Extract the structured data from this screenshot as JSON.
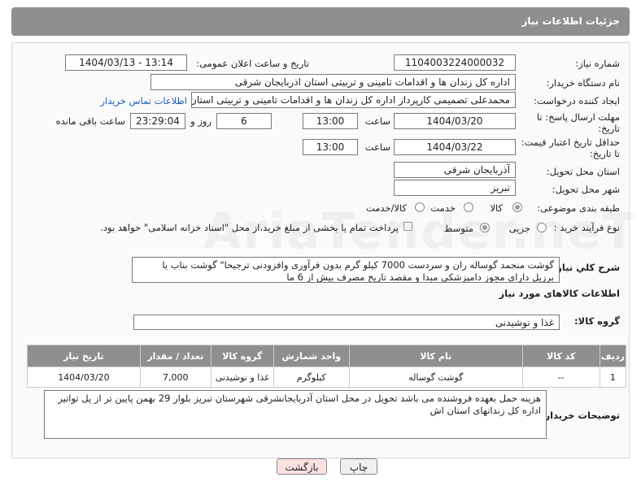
{
  "header": {
    "title": "جزئیات اطلاعات نیاز"
  },
  "form": {
    "need_number": {
      "label": "شماره نیاز:",
      "value": "1104003224000032"
    },
    "announce_datetime": {
      "label": "تاریخ و ساعت اعلان عمومی:",
      "value": "1404/03/13 - 13:14"
    },
    "buyer_org": {
      "label": "نام دستگاه خریدار:",
      "value": "اداره کل زندان ها و اقدامات تامینی و تربیتی استان اذربایجان شرقی"
    },
    "requester": {
      "label": "ایجاد کننده درخواست:",
      "value": "محمدعلی تصمیمی کارپرداز اداره کل زندان ها و اقدامات تامینی و تربیتی استان",
      "contact_link": "اطلاعات تماس خریدار"
    },
    "reply_deadline": {
      "label_1": "مهلت ارسال پاسخ: تا",
      "label_2": "تاریخ:",
      "date": "1404/03/20",
      "time_label": "ساعت",
      "time": "13:00",
      "days": "6",
      "days_label": "روز و",
      "remaining": "23:29:04",
      "remaining_label": "ساعت باقی مانده"
    },
    "price_validity": {
      "label_1": "حداقل تاریخ اعتبار قیمت:",
      "label_2": "تا تاریخ:",
      "date": "1404/03/22",
      "time_label": "ساعت",
      "time": "13:00"
    },
    "delivery_province": {
      "label": "استان محل تحویل:",
      "value": "آذربایجان شرقی"
    },
    "delivery_city": {
      "label": "شهر محل تحویل:",
      "value": "تبریز"
    },
    "category": {
      "label": "طبقه بندی موضوعی:",
      "options": [
        "کالا",
        "خدمت",
        "کالا/خدمت"
      ],
      "selected": "کالا"
    },
    "purchase_type": {
      "label": "نوع فرآیند خرید :",
      "options": [
        "جزیی",
        "متوسط"
      ],
      "selected": "متوسط",
      "note": "پرداخت تمام یا بخشی از مبلغ خرید،از محل \"اسناد خزانه اسلامی\" خواهد بود."
    },
    "description": {
      "label": "شرح کلي نياز:",
      "value": "گوشت منجمد گوساله ران و سردست 7000 کیلو گرم بدون فرآوری وافزودنی ترجیحا\" گوشت بناب یا برزیل دارای مجوز دامپزشکی مبدا و مقصد تاریخ مصرف بیش از 6 ما"
    }
  },
  "goods": {
    "section_title": "اطلاعات کالاهای مورد نیاز",
    "group_label": "گروه کالا:",
    "group_value": "غذا و نوشیدنی",
    "columns": [
      "ردیف",
      "کد کالا",
      "نام کالا",
      "واحد شمارش",
      "گروه کالا",
      "تعداد / مقدار",
      "تاریخ نیاز"
    ],
    "rows": [
      {
        "row": "1",
        "code": "--",
        "name": "گوشت گوساله",
        "unit": "کیلوگرم",
        "group": "غذا و نوشیدنی",
        "qty": "7,000",
        "date": "1404/03/20"
      }
    ]
  },
  "buyer_notes": {
    "label": "توضیحات خریدار:",
    "value": "هزینه حمل بعهده فروشنده می باشد تحویل در محل  استان آذربایجانشرقی شهرستان تبریز بلوار 29 بهمن پایین تر از پل تواتیر اداره کل زندانهای استان اش"
  },
  "buttons": {
    "print": "چاپ",
    "back": "بازگشت"
  },
  "watermark": "AriaTender.neT",
  "colors": {
    "header_bg": "#8f8f8f",
    "link": "#1a5fb4",
    "back_button_bg": "#fbe0e0"
  }
}
